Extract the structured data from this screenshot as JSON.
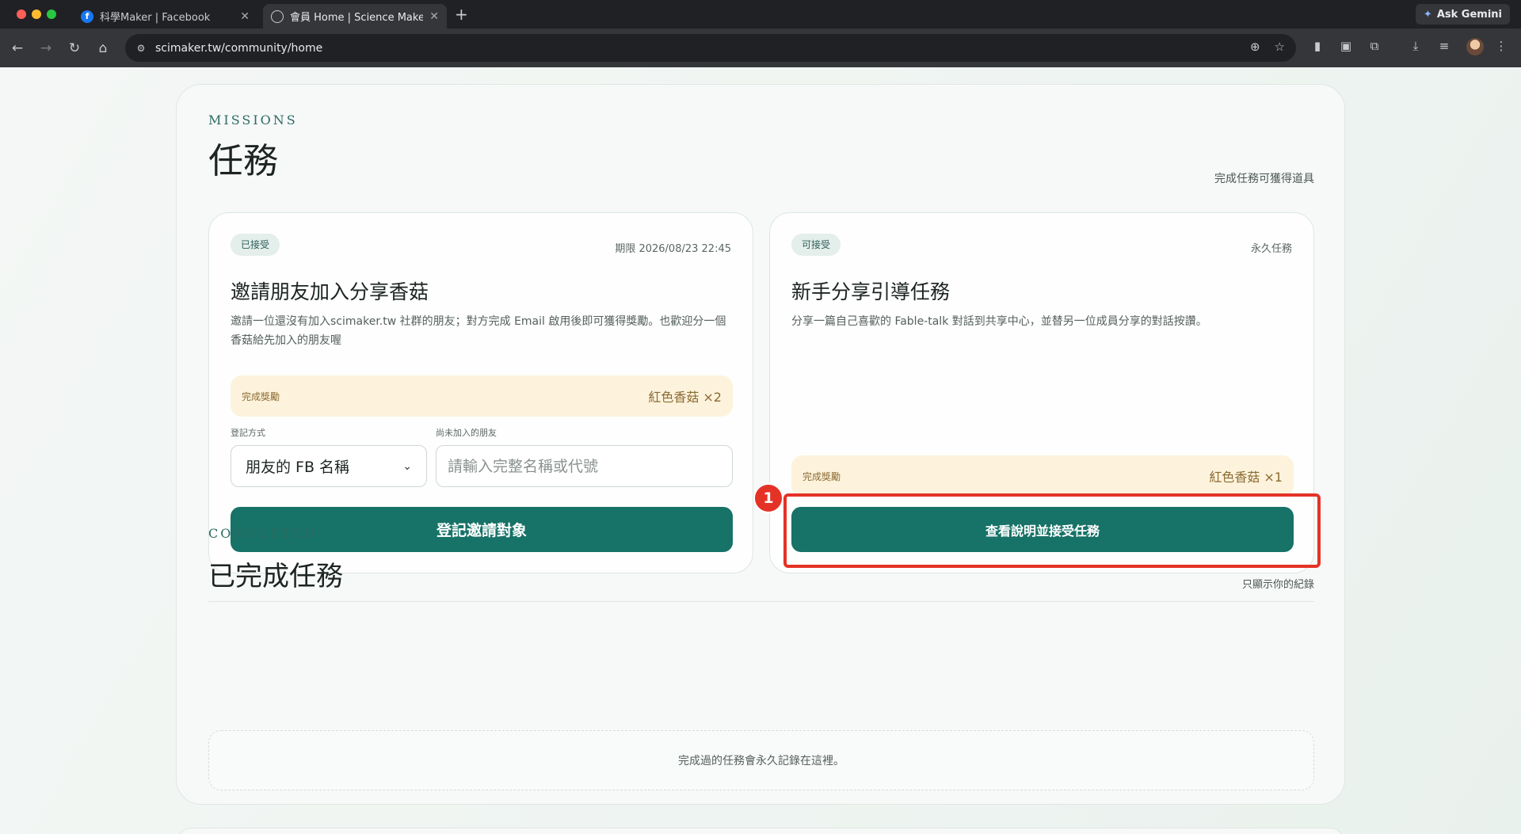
{
  "browser": {
    "tabs": [
      {
        "title": "科學Maker | Facebook",
        "favicon": "facebook-icon",
        "active": false
      },
      {
        "title": "會員 Home | Science Maker",
        "favicon": "globe-icon",
        "active": true
      }
    ],
    "gemini_label": "Ask Gemini",
    "url": "scimaker.tw/community/home"
  },
  "missions": {
    "eyebrow": "MISSIONS",
    "title": "任務",
    "side_note": "完成任務可獲得道具",
    "cards": [
      {
        "status": "已接受",
        "meta": "期限 2026/08/23 22:45",
        "title": "邀請朋友加入分享香菇",
        "description": "邀請一位還沒有加入scimaker.tw 社群的朋友；對方完成 Email 啟用後即可獲得獎勵。也歡迎分一個香菇給先加入的朋友喔",
        "reward_label": "完成獎勵",
        "reward_value": "紅色香菇 ×2",
        "method_label": "登記方式",
        "method_value": "朋友的 FB 名稱",
        "friend_label": "尚未加入的朋友",
        "friend_placeholder": "請輸入完整名稱或代號",
        "button": "登記邀請對象"
      },
      {
        "status": "可接受",
        "meta": "永久任務",
        "title": "新手分享引導任務",
        "description": "分享一篇自己喜歡的 Fable-talk 對話到共享中心，並替另一位成員分享的對話按讚。",
        "reward_label": "完成獎勵",
        "reward_value": "紅色香菇 ×1",
        "button": "查看說明並接受任務"
      }
    ]
  },
  "annotation": {
    "marker": "1",
    "color": "#e53226"
  },
  "completed": {
    "eyebrow": "COMPLETED",
    "title": "已完成任務",
    "side_note": "只顯示你的紀錄",
    "empty_text": "完成過的任務會永久記錄在這裡。"
  },
  "colors": {
    "primary": "#177267",
    "reward_bg": "#fdf3dc",
    "accent_text": "#2a6b62"
  }
}
